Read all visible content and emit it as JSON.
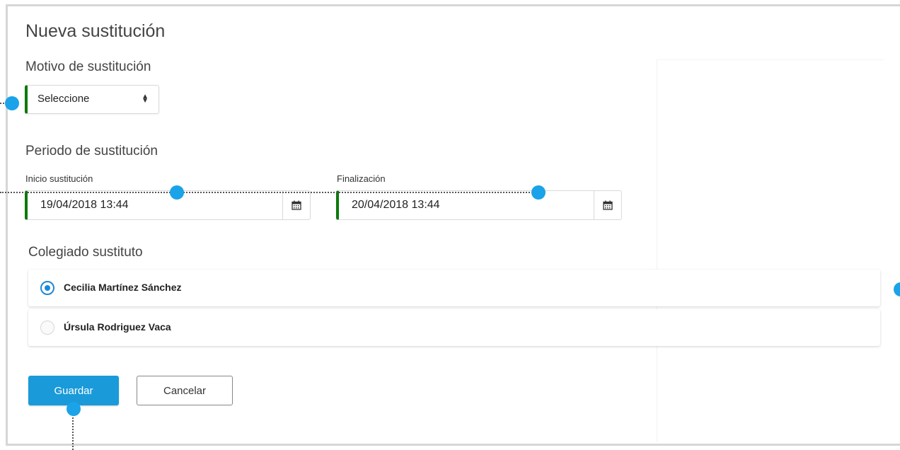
{
  "form": {
    "title": "Nueva sustitución",
    "motivo_label": "Motivo de sustitución",
    "motivo_value": "Seleccione",
    "periodo_label": "Periodo de sustitución",
    "inicio_label": "Inicio sustitución",
    "inicio_value": "19/04/2018 13:44",
    "fin_label": "Finalización",
    "fin_value": "20/04/2018 13:44",
    "colegiado_label": "Colegiado sustituto",
    "options": [
      {
        "name": "Cecilia Martínez Sánchez",
        "selected": true
      },
      {
        "name": "Úrsula Rodriguez Vaca",
        "selected": false
      }
    ],
    "save_label": "Guardar",
    "cancel_label": "Cancelar"
  },
  "icons": {
    "select_arrows": "select-arrows-icon",
    "calendar": "calendar-icon"
  },
  "colors": {
    "accent_green": "#0a7a0a",
    "primary_blue": "#1a9ad9",
    "marker_blue": "#1aa3e8"
  }
}
